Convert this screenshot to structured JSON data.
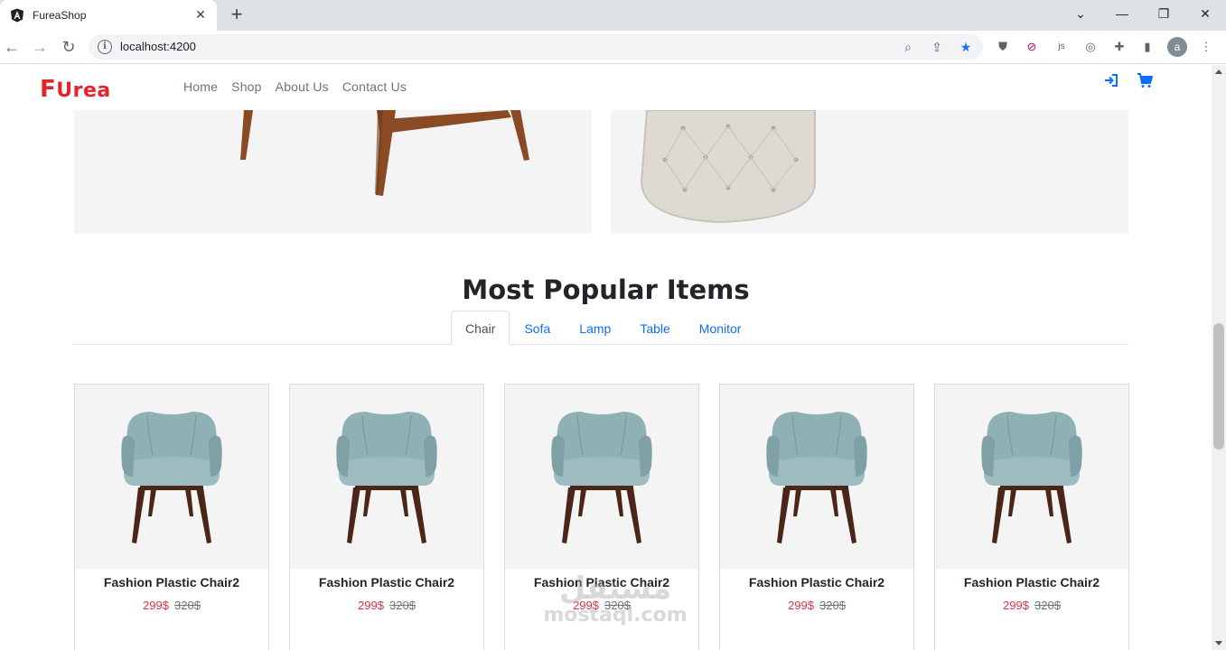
{
  "browser": {
    "tab_title": "FureaShop",
    "url": "localhost:4200",
    "avatar_letter": "a",
    "accent": "#1a73e8"
  },
  "site": {
    "logo_text": "Urea",
    "logo_f": "F",
    "brand_color": "#e3242b",
    "nav": [
      "Home",
      "Shop",
      "About Us",
      "Contact Us"
    ]
  },
  "section": {
    "title": "Most Popular Items",
    "tabs": [
      "Chair",
      "Sofa",
      "Lamp",
      "Table",
      "Monitor"
    ],
    "active_tab": "Chair"
  },
  "products": [
    {
      "name": "Fashion Plastic Chair2",
      "price": "299$",
      "old_price": "320$"
    },
    {
      "name": "Fashion Plastic Chair2",
      "price": "299$",
      "old_price": "320$"
    },
    {
      "name": "Fashion Plastic Chair2",
      "price": "299$",
      "old_price": "320$"
    },
    {
      "name": "Fashion Plastic Chair2",
      "price": "299$",
      "old_price": "320$"
    },
    {
      "name": "Fashion Plastic Chair2",
      "price": "299$",
      "old_price": "320$"
    }
  ],
  "watermark": {
    "arabic": "مستقل",
    "latin": "mostaql.com"
  }
}
